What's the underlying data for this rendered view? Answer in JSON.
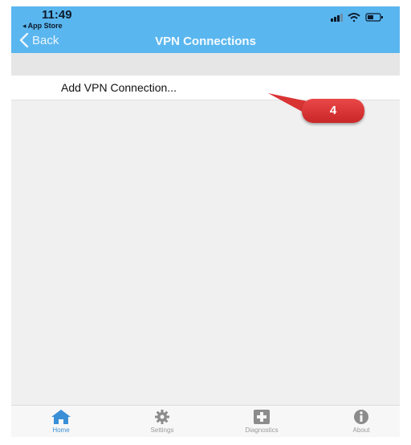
{
  "status": {
    "time": "11:49",
    "back_app": "◂ App Store"
  },
  "nav": {
    "back_label": "Back",
    "title": "VPN Connections"
  },
  "list": {
    "items": [
      {
        "label": "Add VPN Connection..."
      }
    ]
  },
  "callout": {
    "number": "4"
  },
  "tabs": [
    {
      "label": "Home",
      "icon": "home-icon",
      "active": true
    },
    {
      "label": "Settings",
      "icon": "gear-icon",
      "active": false
    },
    {
      "label": "Diagnostics",
      "icon": "plus-box-icon",
      "active": false
    },
    {
      "label": "About",
      "icon": "info-icon",
      "active": false
    }
  ],
  "colors": {
    "header": "#5ab6ef",
    "accent": "#3a8fd6",
    "callout": "#d93434"
  }
}
